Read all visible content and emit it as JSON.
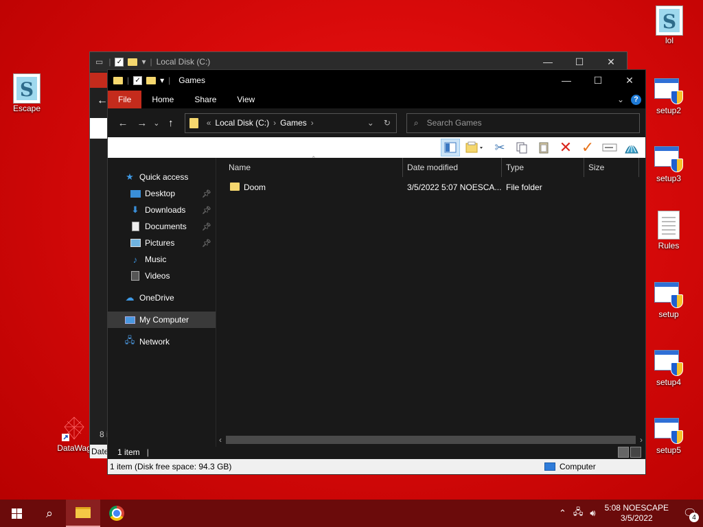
{
  "desktop": {
    "icons": [
      {
        "label": "lol"
      },
      {
        "label": "Escape"
      },
      {
        "label": "setup2"
      },
      {
        "label": "setup3"
      },
      {
        "label": "Rules"
      },
      {
        "label": "setup"
      },
      {
        "label": "setup4"
      },
      {
        "label": "setup5"
      },
      {
        "label": "DataWag"
      }
    ]
  },
  "back_window": {
    "title": "Local Disk (C:)",
    "status_fragment": "8 i",
    "date_fragment": "Date"
  },
  "explorer": {
    "title": "Games",
    "ribbon_tabs": [
      "File",
      "Home",
      "Share",
      "View"
    ],
    "address": {
      "prefix": "«",
      "crumbs": [
        "Local Disk (C:)",
        "Games"
      ]
    },
    "search_placeholder": "Search Games",
    "nav": {
      "quick_access": "Quick access",
      "pinned": [
        {
          "label": "Desktop"
        },
        {
          "label": "Downloads"
        },
        {
          "label": "Documents"
        },
        {
          "label": "Pictures"
        }
      ],
      "unpinned": [
        {
          "label": "Music"
        },
        {
          "label": "Videos"
        }
      ],
      "onedrive": "OneDrive",
      "my_computer": "My Computer",
      "network": "Network"
    },
    "columns": [
      "Name",
      "Date modified",
      "Type",
      "Size"
    ],
    "rows": [
      {
        "name": "Doom",
        "date": "3/5/2022 5:07 NOESCA...",
        "type": "File folder",
        "size": ""
      }
    ],
    "status_count": "1 item",
    "details_text": "1 item (Disk free space: 94.3 GB)",
    "details_location": "Computer"
  },
  "taskbar": {
    "clock_time": "5:08 NOESCAPE",
    "clock_date": "3/5/2022",
    "notification_count": "4"
  }
}
